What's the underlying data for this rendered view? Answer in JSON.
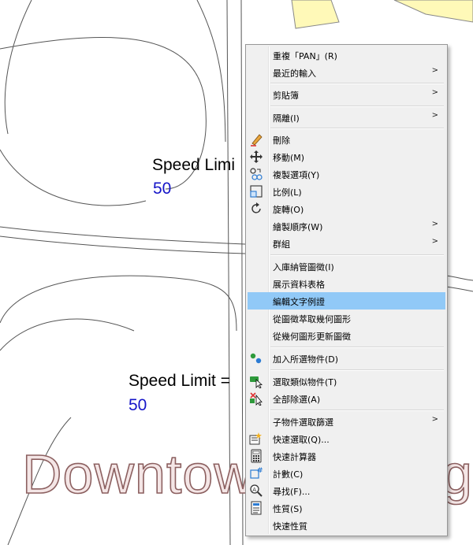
{
  "drawing": {
    "label1": "Speed Limi",
    "value1": "50",
    "label2": "Speed Limit =",
    "value2": "50",
    "watermark_left": "Downtown",
    "watermark_right": "g"
  },
  "context_menu": {
    "items": [
      {
        "label": "重複「PAN」(R)",
        "icon": "",
        "submenu": false
      },
      {
        "label": "最近的輸入",
        "icon": "",
        "submenu": true
      },
      {
        "label": "剪貼簿",
        "icon": "",
        "submenu": true
      },
      {
        "label": "隔離(I)",
        "icon": "",
        "submenu": true
      },
      {
        "label": "刪除",
        "icon": "eraser-icon",
        "submenu": false
      },
      {
        "label": "移動(M)",
        "icon": "move-icon",
        "submenu": false
      },
      {
        "label": "複製選項(Y)",
        "icon": "copy-icon",
        "submenu": false
      },
      {
        "label": "比例(L)",
        "icon": "scale-icon",
        "submenu": false
      },
      {
        "label": "旋轉(O)",
        "icon": "rotate-icon",
        "submenu": false
      },
      {
        "label": "繪製順序(W)",
        "icon": "",
        "submenu": true
      },
      {
        "label": "群組",
        "icon": "",
        "submenu": true
      },
      {
        "label": "入庫納管圖徵(I)",
        "icon": "",
        "submenu": false
      },
      {
        "label": "展示資料表格",
        "icon": "",
        "submenu": false
      },
      {
        "label": "編輯文字例證",
        "icon": "",
        "submenu": false,
        "highlighted": true
      },
      {
        "label": "從圖徵萃取幾何圖形",
        "icon": "",
        "submenu": false
      },
      {
        "label": "從幾何圖形更新圖徵",
        "icon": "",
        "submenu": false
      },
      {
        "label": "加入所選物件(D)",
        "icon": "add-selected-icon",
        "submenu": false
      },
      {
        "label": "選取類似物件(T)",
        "icon": "select-similar-icon",
        "submenu": false
      },
      {
        "label": "全部除選(A)",
        "icon": "deselect-all-icon",
        "submenu": false
      },
      {
        "label": "子物件選取篩選",
        "icon": "",
        "submenu": true
      },
      {
        "label": "快速選取(Q)...",
        "icon": "quick-select-icon",
        "submenu": false
      },
      {
        "label": "快速計算器",
        "icon": "calculator-icon",
        "submenu": false
      },
      {
        "label": "計數(C)",
        "icon": "count-icon",
        "submenu": false
      },
      {
        "label": "尋找(F)...",
        "icon": "find-icon",
        "submenu": false
      },
      {
        "label": "性質(S)",
        "icon": "properties-icon",
        "submenu": false
      },
      {
        "label": "快速性質",
        "icon": "",
        "submenu": false
      }
    ]
  },
  "colors": {
    "menu_background": "#f0f0f0",
    "menu_highlight": "#91c9f7",
    "value_text": "#1515c8",
    "watermark_stroke": "#8c6060",
    "parcel_fill": "#fff9b8"
  }
}
